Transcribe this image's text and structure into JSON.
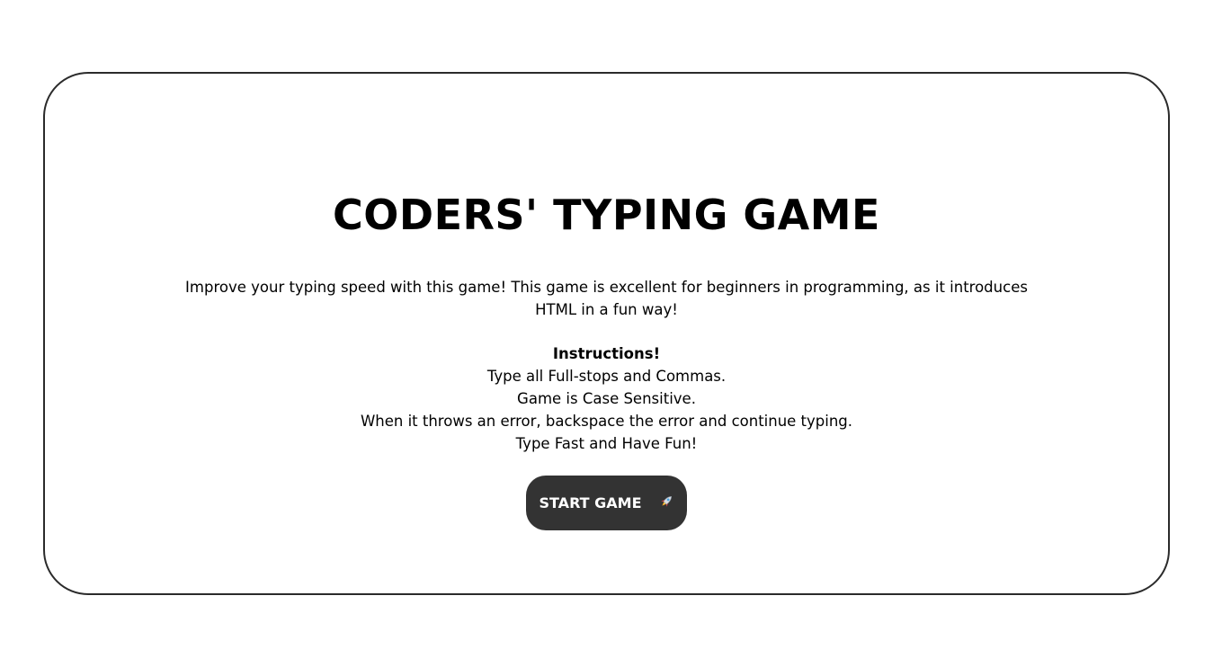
{
  "game": {
    "title": "CODERS' TYPING GAME",
    "description": "Improve your typing speed with this game! This game is excellent for beginners in programming, as it introduces HTML in a fun way!",
    "instructions": {
      "heading": "Instructions!",
      "items": [
        "Type all Full-stops and Commas.",
        "Game is Case Sensitive.",
        "When it throws an error, backspace the error and continue typing.",
        "Type Fast and Have Fun!"
      ]
    },
    "start_button": {
      "label": "START GAME",
      "icon": "rocket-icon"
    }
  },
  "colors": {
    "card_border": "#2b2b2b",
    "button_bg": "#333333",
    "button_text": "#ffffff",
    "text": "#000000"
  }
}
